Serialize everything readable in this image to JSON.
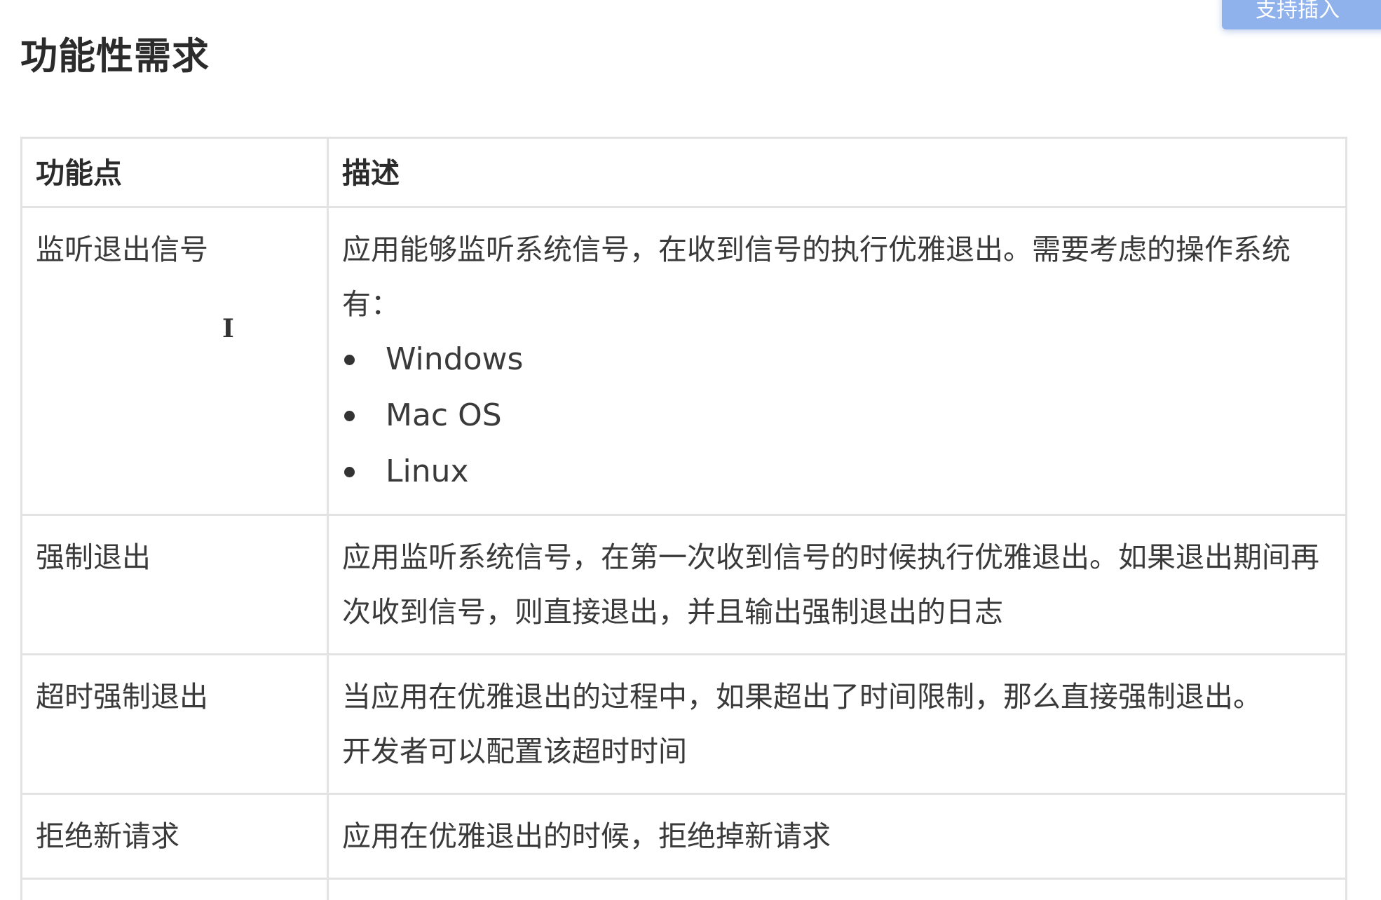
{
  "header": {
    "title": "功能性需求",
    "corner_button_label": "支持插入"
  },
  "table": {
    "columns": [
      "功能点",
      "描述"
    ],
    "rows": [
      {
        "feature": "监听退出信号",
        "description": "应用能够监听系统信号，在收到信号的执行优雅退出。需要考虑的操作系统有：",
        "list": [
          "Windows",
          "Mac OS",
          "Linux"
        ]
      },
      {
        "feature": "强制退出",
        "description": "应用监听系统信号，在第一次收到信号的时候执行优雅退出。如果退出期间再次收到信号，则直接退出，并且输出强制退出的日志"
      },
      {
        "feature": "超时强制退出",
        "description": "当应用在优雅退出的过程中，如果超出了时间限制，那么直接强制退出。",
        "description_extra": "开发者可以配置该超时时间"
      },
      {
        "feature": "拒绝新请求",
        "description": "应用在优雅退出的时候，拒绝掉新请求"
      }
    ]
  },
  "colors": {
    "border": "#e3e3e3",
    "text": "#3a3a3a",
    "accent_button": "#8fb1ec"
  }
}
